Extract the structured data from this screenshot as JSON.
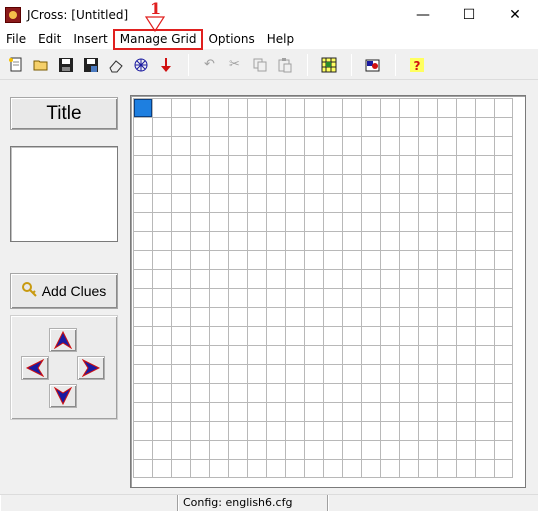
{
  "window": {
    "title": "JCross: [Untitled]",
    "minimize": "—",
    "maximize": "☐",
    "close": "✕"
  },
  "menu": {
    "items": [
      "File",
      "Edit",
      "Insert",
      "Manage Grid",
      "Options",
      "Help"
    ],
    "highlighted": "Manage Grid"
  },
  "annotation": {
    "label": "1",
    "color": "#e0201f"
  },
  "toolbar": {
    "groups": [
      [
        "new-icon",
        "open-icon",
        "save-icon",
        "save-as-icon",
        "eraser-icon",
        "web-icon",
        "down-arrow-icon"
      ],
      [
        "undo-icon",
        "cut-icon",
        "copy-icon",
        "paste-icon"
      ],
      [
        "grid-icon"
      ],
      [
        "export-icon"
      ],
      [
        "help-icon"
      ]
    ]
  },
  "left_panel": {
    "title_button": "Title",
    "add_clues_button": "Add Clues"
  },
  "grid": {
    "columns": 20,
    "rows": 20,
    "selected_cell": [
      0,
      0
    ]
  },
  "status": {
    "config": "Config: english6.cfg"
  },
  "colors": {
    "accent": "#1e7fe0",
    "arrow_blue": "#1a1aa0",
    "arrow_red": "#d01010"
  }
}
